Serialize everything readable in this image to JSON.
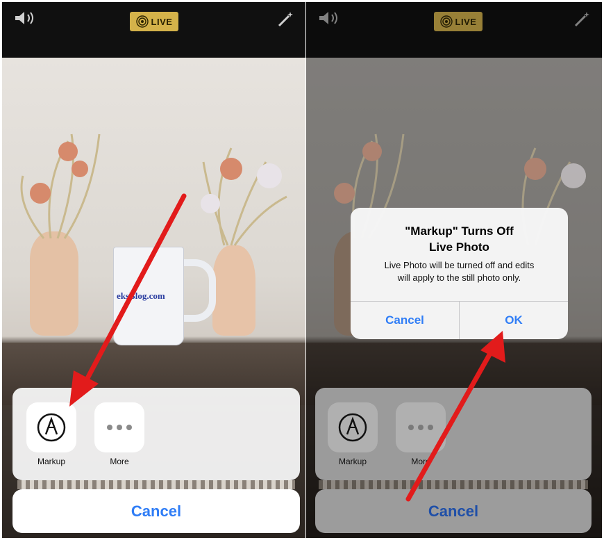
{
  "topbar": {
    "live_label": "LIVE"
  },
  "share_sheet": {
    "actions": [
      {
        "label": "Markup",
        "icon": "markup-icon"
      },
      {
        "label": "More",
        "icon": "more-icon"
      }
    ],
    "cancel_label": "Cancel"
  },
  "photo": {
    "mug_text": "eksBlog.com"
  },
  "alert": {
    "title_line1": "\"Markup\" Turns Off",
    "title_line2": "Live Photo",
    "message_line1": "Live Photo will be turned off and edits",
    "message_line2": "will apply to the still photo only.",
    "cancel_label": "Cancel",
    "ok_label": "OK"
  },
  "colors": {
    "accent_blue": "#2f7df6",
    "live_badge": "#d4b24a",
    "arrow_red": "#e21b1b"
  }
}
